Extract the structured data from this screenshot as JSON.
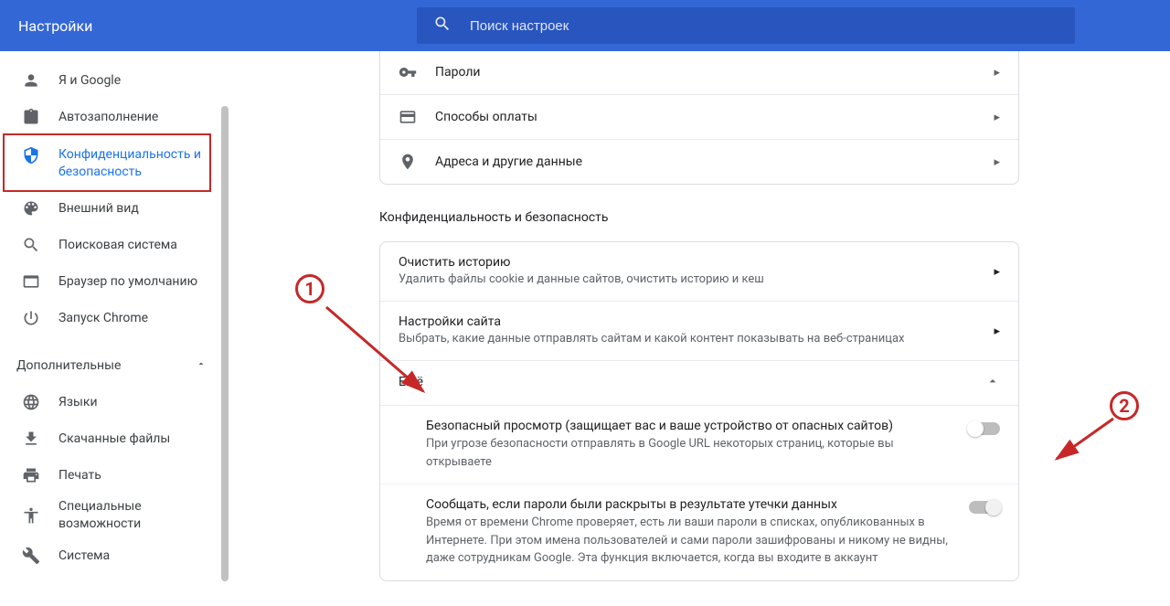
{
  "header": {
    "title": "Настройки",
    "searchPlaceholder": "Поиск настроек"
  },
  "sidebar": {
    "items": [
      {
        "label": "Я и Google"
      },
      {
        "label": "Автозаполнение"
      },
      {
        "label": "Конфиденциальность и безопасность"
      },
      {
        "label": "Внешний вид"
      },
      {
        "label": "Поисковая система"
      },
      {
        "label": "Браузер по умолчанию"
      },
      {
        "label": "Запуск Chrome"
      }
    ],
    "advancedLabel": "Дополнительные",
    "advanced": [
      {
        "label": "Языки"
      },
      {
        "label": "Скачанные файлы"
      },
      {
        "label": "Печать"
      },
      {
        "label": "Специальные возможности"
      },
      {
        "label": "Система"
      }
    ]
  },
  "autofill": {
    "rows": [
      {
        "label": "Пароли"
      },
      {
        "label": "Способы оплаты"
      },
      {
        "label": "Адреса и другие данные"
      }
    ]
  },
  "privacy": {
    "sectionTitle": "Конфиденциальность и безопасность",
    "rows": [
      {
        "title": "Очистить историю",
        "desc": "Удалить файлы cookie и данные сайтов, очистить историю и кеш"
      },
      {
        "title": "Настройки сайта",
        "desc": "Выбрать, какие данные отправлять сайтам и какой контент показывать на веб-страницах"
      }
    ],
    "more": {
      "label": "Ещё",
      "items": [
        {
          "title": "Безопасный просмотр (защищает вас и ваше устройство от опасных сайтов)",
          "desc": "При угрозе безопасности отправлять в Google URL некоторых страниц, которые вы открываете"
        },
        {
          "title": "Сообщать, если пароли были раскрыты в результате утечки данных",
          "desc": "Время от времени Chrome проверяет, есть ли ваши пароли в списках, опубликованных в Интернете. При этом имена пользователей и сами пароли зашифрованы и никому не видны, даже сотрудникам Google. Эта функция включается, когда вы входите в аккаунт"
        }
      ]
    }
  },
  "annotations": {
    "one": "1",
    "two": "2"
  }
}
